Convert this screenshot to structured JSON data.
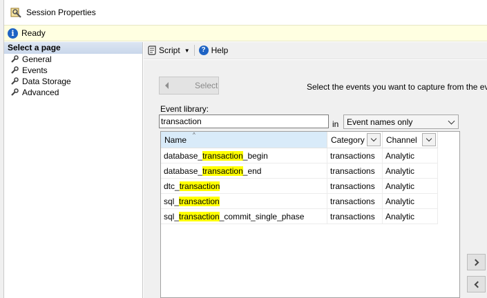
{
  "window": {
    "title": "Session Properties"
  },
  "status": {
    "text": "Ready"
  },
  "sidebar": {
    "header": "Select a page",
    "items": [
      {
        "label": "General",
        "icon": "wrench-icon"
      },
      {
        "label": "Events",
        "icon": "wrench-icon"
      },
      {
        "label": "Data Storage",
        "icon": "wrench-icon"
      },
      {
        "label": "Advanced",
        "icon": "wrench-icon"
      }
    ]
  },
  "toolbar": {
    "script_label": "Script",
    "help_label": "Help"
  },
  "events": {
    "select_button": "Select",
    "hint": "Select the events you want to capture from the event lib",
    "library_label": "Event library:",
    "search_value": "transaction",
    "in_label": "in",
    "scope_value": "Event names only",
    "columns": {
      "name": "Name",
      "category": "Category",
      "channel": "Channel"
    },
    "rows": [
      {
        "pre": "database_",
        "match": "transaction",
        "post": "_begin",
        "category": "transactions",
        "channel": "Analytic"
      },
      {
        "pre": "database_",
        "match": "transaction",
        "post": "_end",
        "category": "transactions",
        "channel": "Analytic"
      },
      {
        "pre": "dtc_",
        "match": "transaction",
        "post": "",
        "category": "transactions",
        "channel": "Analytic"
      },
      {
        "pre": "sql_",
        "match": "transaction",
        "post": "",
        "category": "transactions",
        "channel": "Analytic"
      },
      {
        "pre": "sql_",
        "match": "transaction",
        "post": "_commit_single_phase",
        "category": "transactions",
        "channel": "Analytic"
      }
    ]
  },
  "colors": {
    "highlight": "#ffff00",
    "status_bg": "#ffffe1",
    "sidebar_header": "#c9d7eb",
    "accent": "#1e63c4"
  }
}
